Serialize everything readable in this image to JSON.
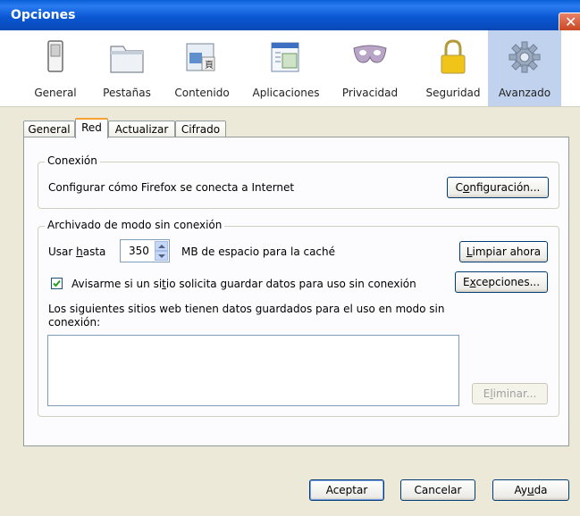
{
  "window": {
    "title": "Opciones"
  },
  "toolbar": {
    "items": [
      {
        "label": "General",
        "icon": "switch-icon",
        "active": false
      },
      {
        "label": "Pestañas",
        "icon": "tabs-icon",
        "active": false
      },
      {
        "label": "Contenido",
        "icon": "content-icon",
        "active": false
      },
      {
        "label": "Aplicaciones",
        "icon": "applications-icon",
        "active": false
      },
      {
        "label": "Privacidad",
        "icon": "mask-icon",
        "active": false
      },
      {
        "label": "Seguridad",
        "icon": "padlock-icon",
        "active": false
      },
      {
        "label": "Avanzado",
        "icon": "gear-icon",
        "active": true
      }
    ]
  },
  "tabs": [
    {
      "label": "General",
      "active": false
    },
    {
      "label": "Red",
      "active": true
    },
    {
      "label": "Actualizar",
      "active": false
    },
    {
      "label": "Cifrado",
      "active": false
    }
  ],
  "connection": {
    "legend": "Conexión",
    "description": "Configurar cómo Firefox se conecta a Internet",
    "settings_button": {
      "pre": "C",
      "mnemonic": "o",
      "post": "nfiguración..."
    }
  },
  "offline": {
    "legend": "Archivado de modo sin conexión",
    "use_up_to": {
      "pre": "Usar ",
      "mnemonic": "h",
      "post": "asta"
    },
    "cache_value": "350",
    "cache_unit_text": "MB de espacio para la caché",
    "clear_button": {
      "pre": "",
      "mnemonic": "L",
      "post": "impiar ahora"
    },
    "notify_checkbox": {
      "checked": true,
      "pre": "Avisarme si un si",
      "mnemonic": "t",
      "post": "io solicita guardar datos para uso sin conexión"
    },
    "exceptions_button": {
      "pre": "E",
      "mnemonic": "x",
      "post": "cepciones..."
    },
    "sites_text_line1": "Los siguientes sitios web tienen datos guardados para el uso en modo sin",
    "sites_text_line2": "conexión:",
    "remove_button": {
      "pre": "E",
      "mnemonic": "l",
      "post": "iminar..."
    }
  },
  "footer": {
    "accept": "Aceptar",
    "cancel": "Cancelar",
    "help": {
      "pre": "Ay",
      "mnemonic": "u",
      "post": "da"
    }
  },
  "colors": {
    "titlebar": "#0b58d4",
    "active_tool": "#c1d2ee",
    "tab_highlight": "#f5a232",
    "window_bg": "#ece9d8"
  }
}
